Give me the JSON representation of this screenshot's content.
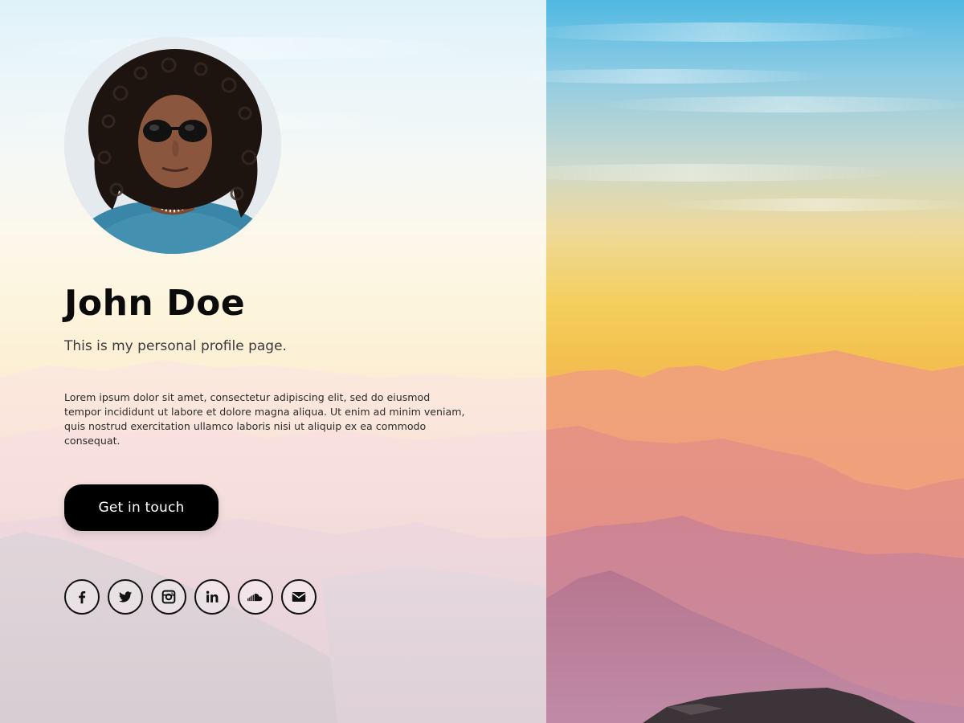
{
  "profile": {
    "name": "John Doe",
    "tagline": "This is my personal profile page.",
    "bio": "Lorem ipsum dolor sit amet, consectetur adipiscing elit, sed do eiusmod tempor incididunt ut labore et dolore magna aliqua. Ut enim ad minim veniam, quis nostrud exercitation ullamco laboris nisi ut aliquip ex ea commodo consequat.",
    "cta_label": "Get in touch"
  },
  "socials": [
    {
      "icon": "facebook-icon"
    },
    {
      "icon": "twitter-icon"
    },
    {
      "icon": "instagram-icon"
    },
    {
      "icon": "linkedin-icon"
    },
    {
      "icon": "soundcloud-icon"
    },
    {
      "icon": "email-icon"
    }
  ],
  "colors": {
    "accent": "#000000",
    "sky_top": "#57b9e0",
    "sky_horizon": "#f2c94c",
    "mountains": "#c88a9a"
  }
}
